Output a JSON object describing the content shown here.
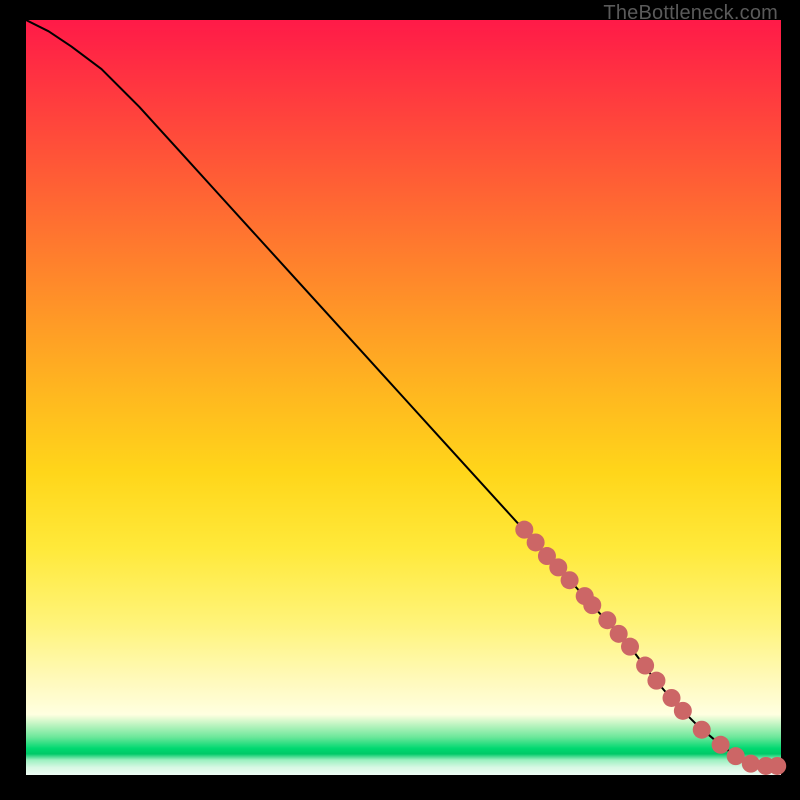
{
  "watermark": "TheBottleneck.com",
  "chart_data": {
    "type": "line",
    "title": "",
    "xlabel": "",
    "ylabel": "",
    "xlim": [
      0,
      100
    ],
    "ylim": [
      0,
      100
    ],
    "grid": false,
    "legend": false,
    "series": [
      {
        "name": "bottleneck-curve",
        "type": "line",
        "color": "#000000",
        "x": [
          0,
          3,
          6,
          10,
          15,
          20,
          25,
          30,
          35,
          40,
          45,
          50,
          55,
          60,
          65,
          70,
          75,
          80,
          83,
          86,
          89,
          92,
          94,
          96,
          98,
          100
        ],
        "values": [
          100,
          98.5,
          96.5,
          93.5,
          88.5,
          83,
          77.5,
          72,
          66.5,
          61,
          55.5,
          50,
          44.5,
          39,
          33.5,
          28,
          22.5,
          17,
          13,
          9.5,
          6.5,
          4,
          2.5,
          1.5,
          1.2,
          1.2
        ]
      },
      {
        "name": "highlighted-points",
        "type": "scatter",
        "color": "#cc6666",
        "x": [
          66,
          67.5,
          69,
          70.5,
          72,
          74,
          75,
          77,
          78.5,
          80,
          82,
          83.5,
          85.5,
          87,
          89.5,
          92,
          94,
          96,
          98,
          99.5
        ],
        "values": [
          32.5,
          30.8,
          29,
          27.5,
          25.8,
          23.7,
          22.5,
          20.5,
          18.7,
          17,
          14.5,
          12.5,
          10.2,
          8.5,
          6,
          4,
          2.5,
          1.5,
          1.2,
          1.2
        ]
      }
    ]
  }
}
